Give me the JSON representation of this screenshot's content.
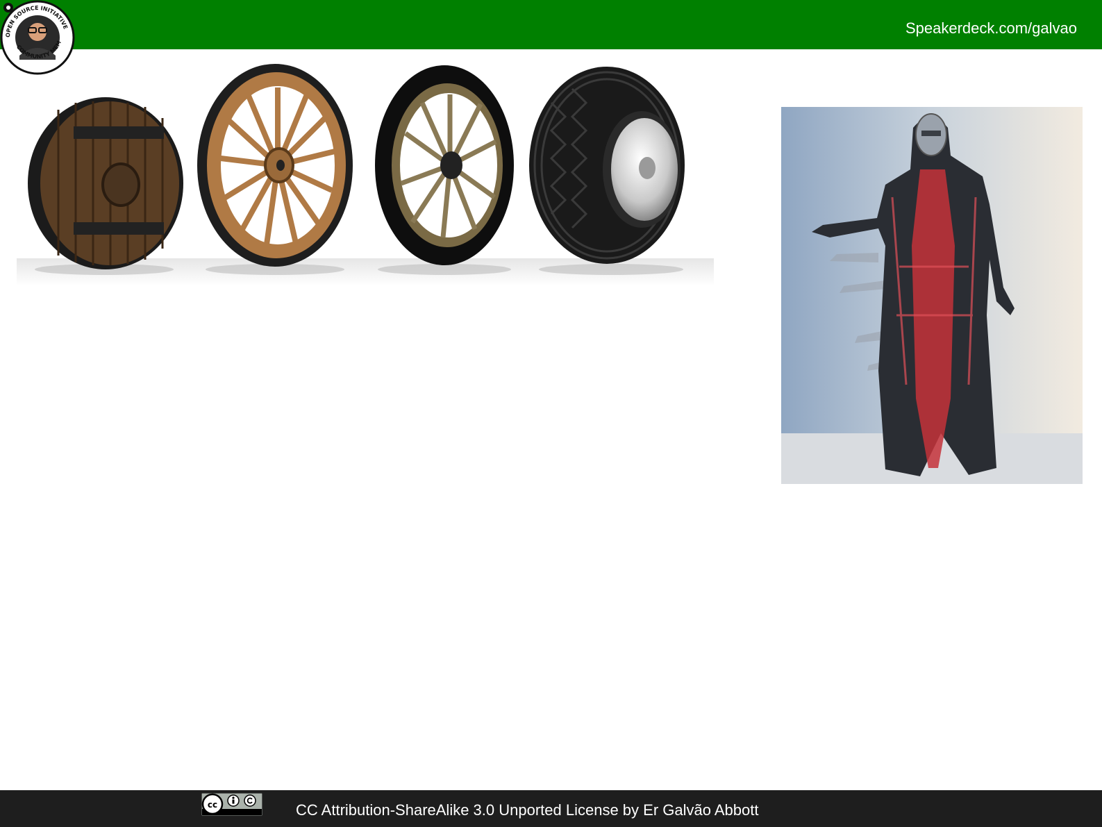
{
  "header": {
    "link_text": "Speakerdeck.com/galvao",
    "color": "#008000",
    "badge_icon": "open-source-initiative-community-member-badge"
  },
  "images": {
    "wheels": "wheel-evolution-image",
    "figure": "transparent-robot-figure-image"
  },
  "footer": {
    "license_text": "CC Attribution-ShareAlike 3.0 Unported License by Er Galvão Abbott",
    "license_icon": "cc-by-sa-badge",
    "color": "#1e1e1e"
  }
}
